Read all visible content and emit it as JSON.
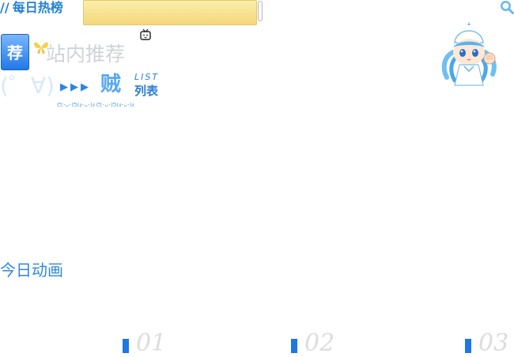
{
  "hot_section": {
    "slashes": "//",
    "title": "每日热榜"
  },
  "recommend": {
    "badge": "荐",
    "title": "站内推荐"
  },
  "list_banner": {
    "kaomoji": "(゜∀)",
    "arrows": "▶▶▶",
    "big_char": "贼",
    "en_label": "LIST",
    "cn_label": "列表",
    "small_kaomoji": "ᕦ(･ᴗ･)ᕤ(ง･ᴗ･)ง ᕦ(･ᴗ･)ᕤ(ง･ᴗ･)ง"
  },
  "today": {
    "title": "今日动画"
  },
  "days": [
    {
      "number": "01"
    },
    {
      "number": "02"
    },
    {
      "number": "03"
    }
  ],
  "colors": {
    "accent_blue": "#1f7fd7",
    "ticker_yellow": "#f3d77a",
    "watermark_gray": "#cfd3d8"
  },
  "icons": [
    "search-icon",
    "tv-icon",
    "butterfly-icon",
    "mascot"
  ]
}
